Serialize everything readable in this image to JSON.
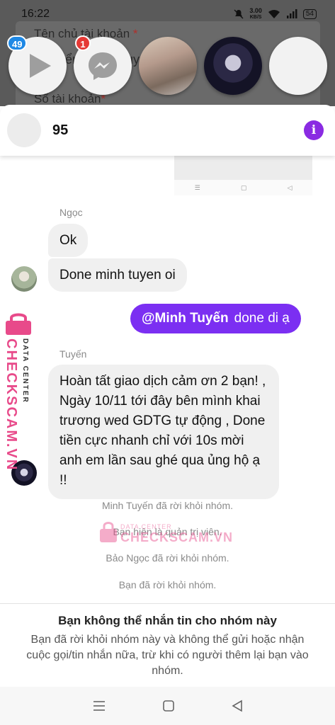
{
  "status_bar": {
    "time": "16:22",
    "net_speed_value": "3.00",
    "net_speed_unit": "KB/S",
    "battery": "54"
  },
  "background_form": {
    "owner_label": "Tên chủ tài khoản",
    "owner_partial": "ển",
    "owner_partial2": "uy",
    "account_label": "Số tài khoản",
    "required_mark": "*"
  },
  "chat_heads": {
    "video_badge": "49",
    "messenger_badge": "1"
  },
  "conversation": {
    "title": "95"
  },
  "messages": [
    {
      "sender": "Ngọc",
      "text": "Ok"
    },
    {
      "text": "Done minh tuyen oi"
    },
    {
      "mention": "@Minh Tuyến",
      "text": "done di ạ"
    },
    {
      "sender": "Tuyến",
      "text": "Hoàn tất giao dịch cảm ơn 2 bạn! ,  Ngày 10/11 tới đây bên mình khai trương wed GDTG tự động ,  Done tiền cực nhanh chỉ với 10s mời anh em lần sau ghé qua ủng hộ ạ !!"
    }
  ],
  "system_messages": [
    "Minh Tuyến đã rời khỏi nhóm.",
    "Bạn hiện là quản trị viên.",
    "Bảo Ngọc đã rời khỏi nhóm.",
    "Bạn đã rời khỏi nhóm."
  ],
  "watermark": {
    "brand": "CHECKSCAM.VN",
    "sub": "DATA CENTER"
  },
  "notice": {
    "title": "Bạn không thể nhắn tin cho nhóm này",
    "body": "Bạn đã rời khỏi nhóm này và không thể gửi hoặc nhận cuộc gọi/tin nhắn nữa, trừ khi có người thêm lại bạn vào nhóm."
  },
  "colors": {
    "accent": "#7b2ff2",
    "info": "#8a2be2",
    "badge": "#1e88e5",
    "badge_red": "#e53935",
    "watermark": "#e84a8a"
  }
}
